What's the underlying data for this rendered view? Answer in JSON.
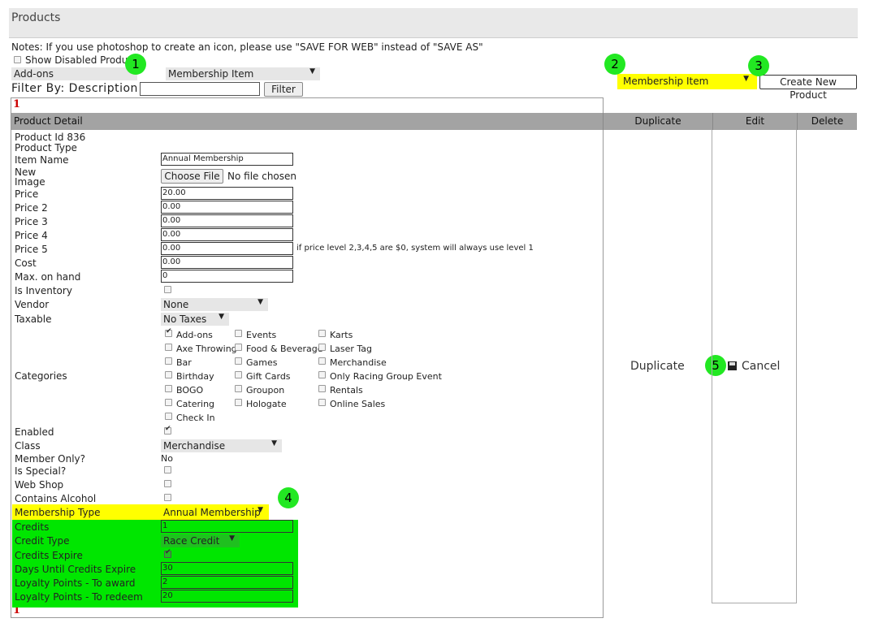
{
  "page": {
    "title": "Products",
    "notes": "Notes: If you use photoshop to create an icon, please use \"SAVE FOR WEB\" instead of \"SAVE AS\"",
    "show_disabled_label": "Show Disabled Products",
    "category_select": "Add-ons",
    "type_select": "Membership Item",
    "filter_label": "Filter By: Description",
    "filter_button": "Filter",
    "new_type_select": "Membership Item",
    "create_button": "Create New Product",
    "red_marker_top": "1",
    "red_marker_bottom": "1"
  },
  "badges": [
    "1",
    "2",
    "3",
    "4",
    "5"
  ],
  "table": {
    "headers": [
      "Product Detail",
      "Duplicate",
      "Edit",
      "Delete"
    ],
    "duplicate_link": "Duplicate",
    "cancel_link": "Cancel"
  },
  "product": {
    "id_label": "Product Id 836",
    "type_label": "Product Type",
    "item_name_label": "Item Name",
    "item_name": "Annual Membership",
    "new_label": "New",
    "image_label": "Image",
    "choose_file": "Choose File",
    "no_file": "No file chosen",
    "price_label": "Price",
    "price": "20.00",
    "price2_label": "Price 2",
    "price2": "0.00",
    "price3_label": "Price 3",
    "price3": "0.00",
    "price4_label": "Price 4",
    "price4": "0.00",
    "price5_label": "Price 5",
    "price5": "0.00",
    "price_note": "if price level 2,3,4,5 are $0, system will always use level 1",
    "cost_label": "Cost",
    "cost": "0.00",
    "max_label": "Max. on hand",
    "max": "0",
    "inventory_label": "Is Inventory",
    "vendor_label": "Vendor",
    "vendor": "None",
    "taxable_label": "Taxable",
    "taxable": "No Taxes",
    "categories_label": "Categories",
    "categories": [
      {
        "label": "Add-ons",
        "checked": true
      },
      {
        "label": "Events",
        "checked": false
      },
      {
        "label": "Karts",
        "checked": false
      },
      {
        "label": "Axe Throwing",
        "checked": false
      },
      {
        "label": "Food & Beverage",
        "checked": false
      },
      {
        "label": "Laser Tag",
        "checked": false
      },
      {
        "label": "Bar",
        "checked": false
      },
      {
        "label": "Games",
        "checked": false
      },
      {
        "label": "Merchandise",
        "checked": false
      },
      {
        "label": "Birthday",
        "checked": false
      },
      {
        "label": "Gift Cards",
        "checked": false
      },
      {
        "label": "Only Racing Group Event",
        "checked": false
      },
      {
        "label": "BOGO",
        "checked": false
      },
      {
        "label": "Groupon",
        "checked": false
      },
      {
        "label": "Rentals",
        "checked": false
      },
      {
        "label": "Catering",
        "checked": false
      },
      {
        "label": "Hologate",
        "checked": false
      },
      {
        "label": "Online Sales",
        "checked": false
      },
      {
        "label": "Check In",
        "checked": false
      }
    ],
    "enabled_label": "Enabled",
    "class_label": "Class",
    "class": "Merchandise",
    "member_only_label": "Member Only?",
    "member_only": "No",
    "special_label": "Is Special?",
    "webshop_label": "Web Shop",
    "alcohol_label": "Contains Alcohol",
    "membership_type_label": "Membership Type",
    "membership_type": "Annual Membership",
    "credits_label": "Credits",
    "credits": "1",
    "credit_type_label": "Credit Type",
    "credit_type": "Race Credit",
    "credits_expire_label": "Credits Expire",
    "days_label": "Days Until Credits Expire",
    "days": "30",
    "award_label": "Loyalty Points - To award",
    "award": "2",
    "redeem_label": "Loyalty Points - To redeem",
    "redeem": "20"
  },
  "colors": {
    "highlight_yellow": "#ffff00",
    "highlight_green": "#00e600",
    "badge_green": "#22e822",
    "header_gray": "#a3a3a3"
  },
  "icons": {
    "save": "floppy-disk-icon",
    "dropdown": "chevron-down-icon"
  }
}
